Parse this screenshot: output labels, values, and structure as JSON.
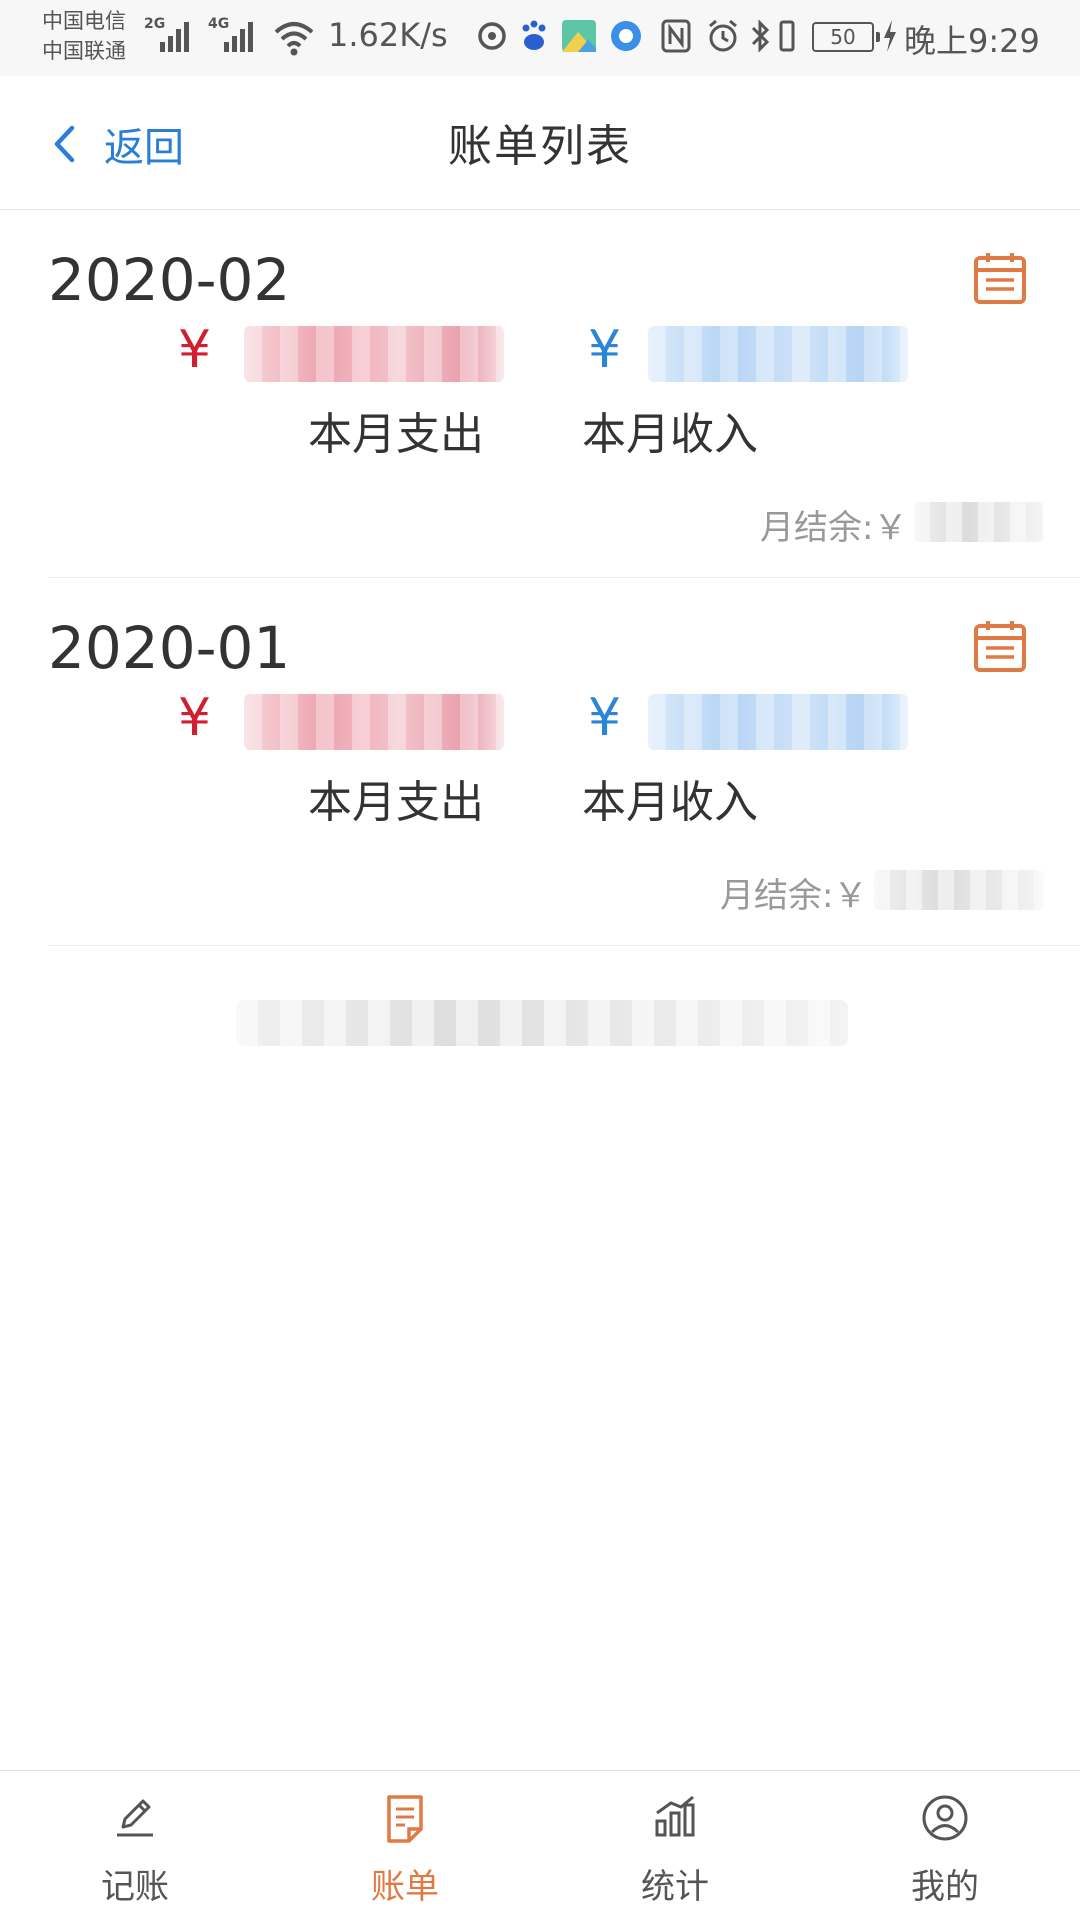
{
  "status_bar": {
    "carrier_1": "中国电信",
    "carrier_2": "中国联通",
    "net_1": "2G",
    "net_2": "4G",
    "net_speed": "1.62K/s",
    "battery": "50",
    "time": "晚上9:29"
  },
  "nav": {
    "back_label": "返回",
    "title": "账单列表"
  },
  "bills": [
    {
      "month": "2020-02",
      "expense_symbol": "¥",
      "income_symbol": "¥",
      "expense_label": "本月支出",
      "income_label": "本月收入",
      "balance_label": "月结余:￥"
    },
    {
      "month": "2020-01",
      "expense_symbol": "¥",
      "income_symbol": "¥",
      "expense_label": "本月支出",
      "income_label": "本月收入",
      "balance_label": "月结余:￥"
    }
  ],
  "tabs": [
    {
      "label": "记账",
      "icon": "pencil-icon"
    },
    {
      "label": "账单",
      "icon": "bill-icon"
    },
    {
      "label": "统计",
      "icon": "chart-icon"
    },
    {
      "label": "我的",
      "icon": "user-icon"
    }
  ],
  "active_tab": 1,
  "colors": {
    "accent_orange": "#e07a44",
    "back_blue": "#2a7fd4",
    "expense_red": "#d01f30",
    "income_blue": "#2a86d8"
  }
}
